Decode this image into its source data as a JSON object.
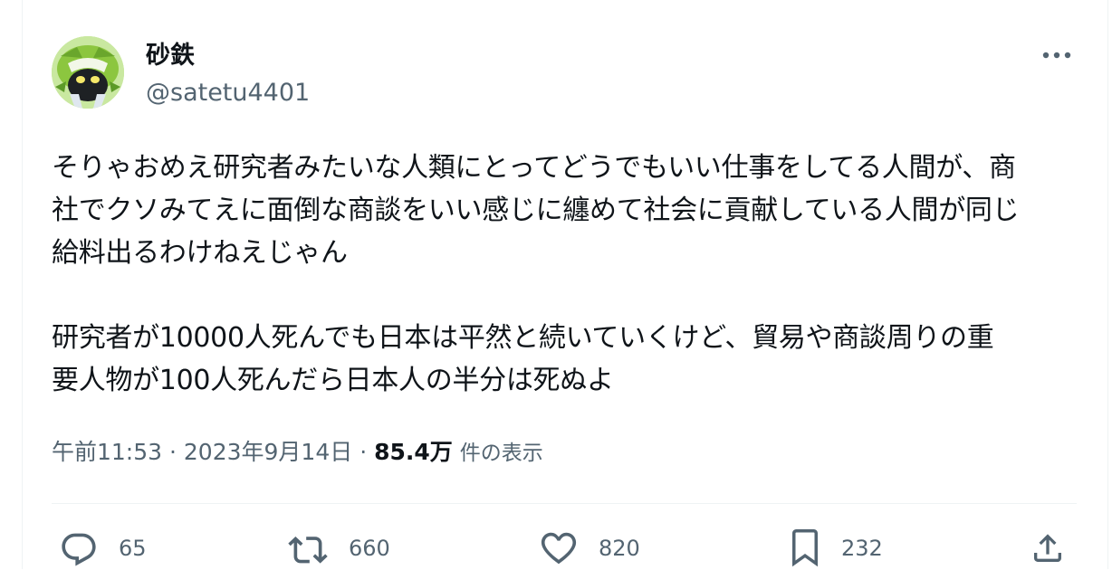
{
  "author": {
    "display_name": "砂鉄",
    "handle": "@satetu4401"
  },
  "tweet": {
    "text": "そりゃおめえ研究者みたいな人類にとってどうでもいい仕事をしてる人間が、商\n社でクソみてえに面倒な商談をいい感じに纏めて社会に貢献している人間が同じ\n給料出るわけねえじゃん\n\n研究者が10000人死んでも日本は平然と続いていくけど、貿易や商談周りの重\n要人物が100人死んだら日本人の半分は死ぬよ"
  },
  "meta": {
    "time": "午前11:53",
    "separator": "·",
    "date": "2023年9月14日",
    "views_count": "85.4万",
    "views_label": "件の表示"
  },
  "actions": {
    "replies": "65",
    "retweets": "660",
    "likes": "820",
    "bookmarks": "232"
  },
  "icons": {
    "more": "more-horizontal-icon",
    "reply": "reply-icon",
    "retweet": "retweet-icon",
    "like": "heart-icon",
    "bookmark": "bookmark-icon",
    "share": "share-icon"
  },
  "colors": {
    "text_primary": "#0f1419",
    "text_secondary": "#536471",
    "divider": "#eff3f4",
    "avatar_green": "#8cc63f"
  }
}
